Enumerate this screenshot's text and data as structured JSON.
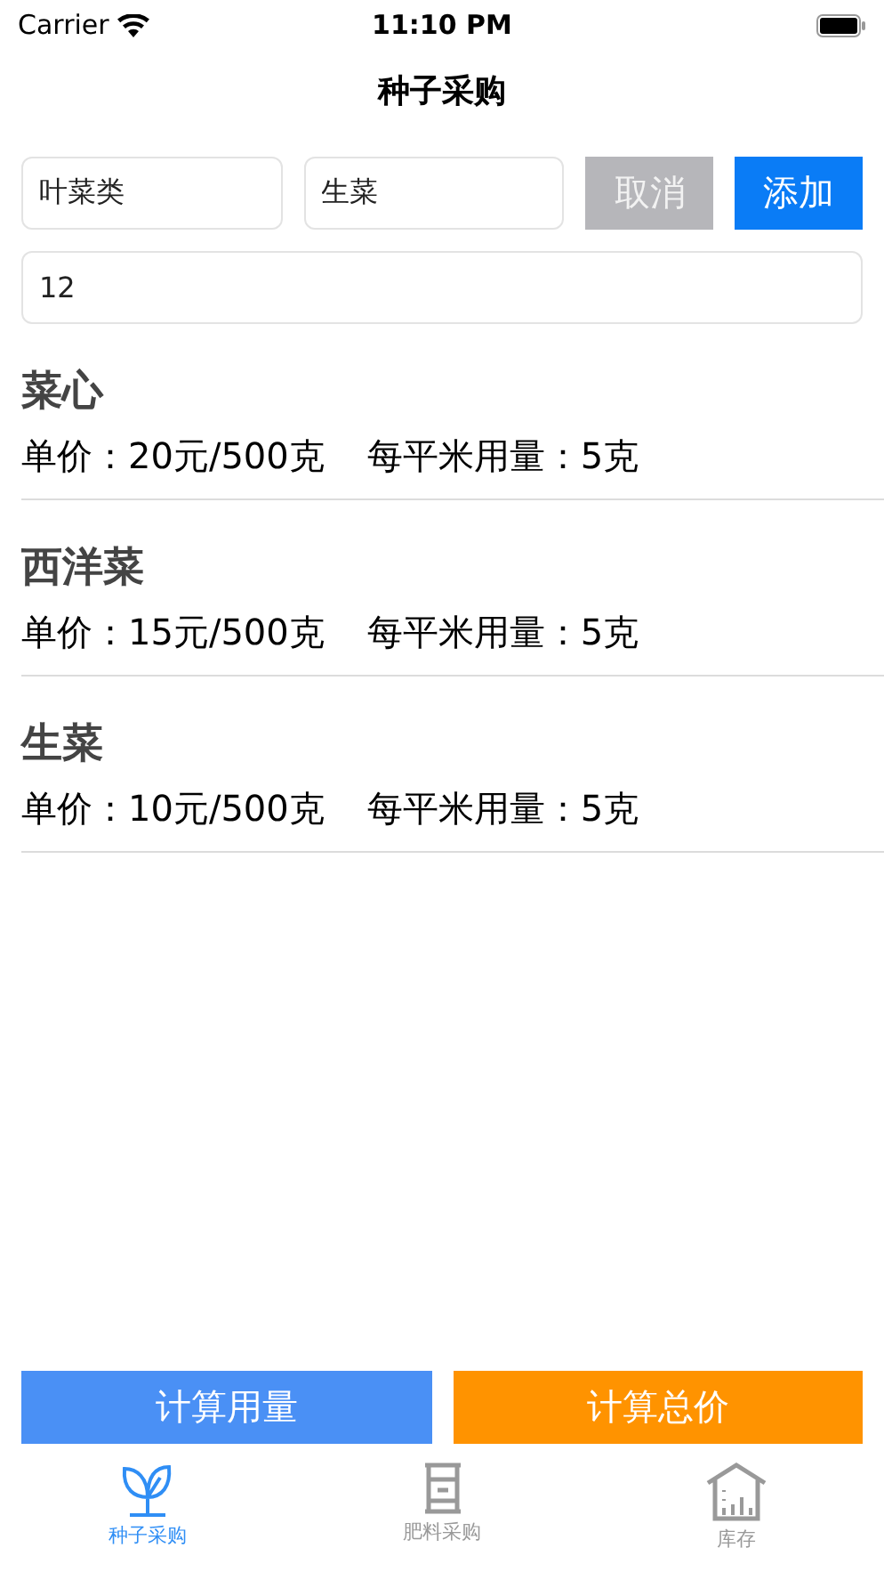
{
  "status_bar": {
    "carrier": "Carrier",
    "time": "11:10 PM"
  },
  "title": "种子采购",
  "form": {
    "category": "叶菜类",
    "name": "生菜",
    "amount": "12",
    "cancel": "取消",
    "add": "添加"
  },
  "items": [
    {
      "name": "菜心",
      "price_label": "单价：",
      "price": "20元/500克",
      "usage_label": "每平米用量：",
      "usage": "5克"
    },
    {
      "name": "西洋菜",
      "price_label": "单价：",
      "price": "15元/500克",
      "usage_label": "每平米用量：",
      "usage": "5克"
    },
    {
      "name": "生菜",
      "price_label": "单价：",
      "price": "10元/500克",
      "usage_label": "每平米用量：",
      "usage": "5克"
    }
  ],
  "actions": [
    {
      "label": "计算用量",
      "kind": "usage"
    },
    {
      "label": "计算总价",
      "kind": "total"
    }
  ],
  "tabs": [
    {
      "label": "种子采购",
      "selected": true
    },
    {
      "label": "肥料采购",
      "selected": false
    },
    {
      "label": "库存",
      "selected": false
    }
  ]
}
